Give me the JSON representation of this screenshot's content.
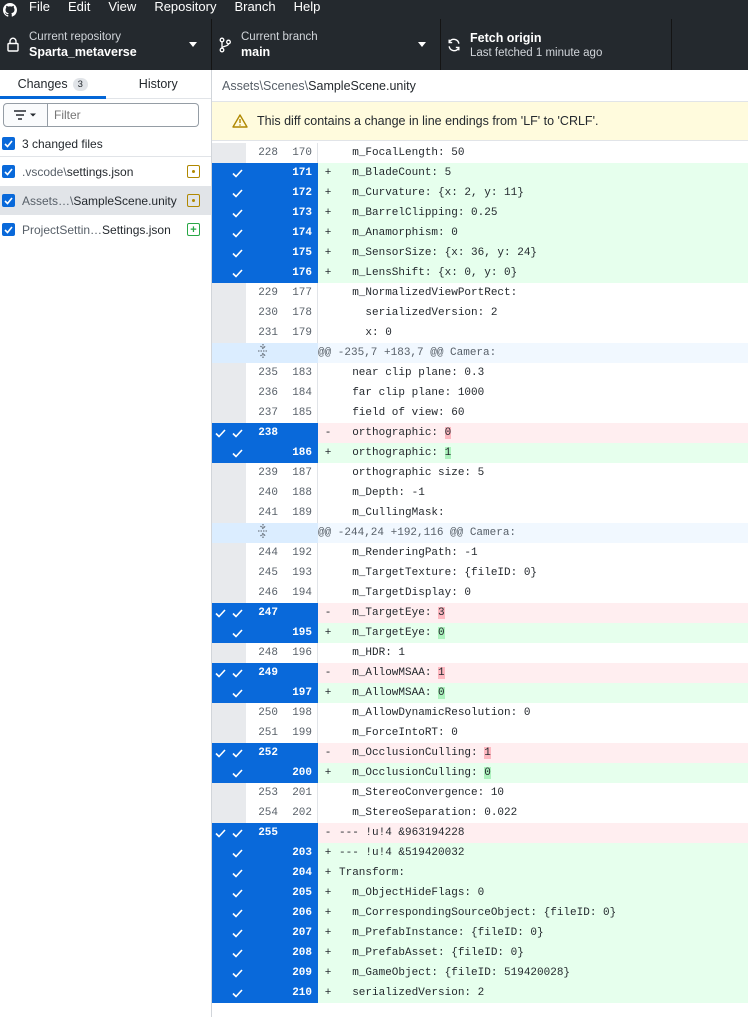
{
  "menu": [
    "File",
    "Edit",
    "View",
    "Repository",
    "Branch",
    "Help"
  ],
  "toolbar": {
    "repo_label": "Current repository",
    "repo_value": "Sparta_metaverse",
    "branch_label": "Current branch",
    "branch_value": "main",
    "fetch_label": "Fetch origin",
    "fetch_sub": "Last fetched 1 minute ago"
  },
  "sidebar": {
    "tab_changes": "Changes",
    "tab_changes_count": "3",
    "tab_history": "History",
    "filter_placeholder": "Filter",
    "changed_files": "3 changed files",
    "files": [
      {
        "prefix": ".vscode\\",
        "name": "settings.json",
        "status": "modified"
      },
      {
        "prefix": "Assets…\\",
        "name": "SampleScene.unity",
        "status": "modified"
      },
      {
        "prefix": "ProjectSettin…",
        "name": "Settings.json",
        "status": "added"
      }
    ]
  },
  "main": {
    "breadcrumb_path": "Assets\\Scenes\\",
    "breadcrumb_file": "SampleScene.unity",
    "warning": "This diff contains a change in line endings from 'LF' to 'CRLF'."
  },
  "diff": [
    {
      "t": "ctx",
      "o": "228",
      "n": "170",
      "c": "  m_FocalLength: 50"
    },
    {
      "t": "add",
      "o": "",
      "n": "171",
      "c": "  m_BladeCount: 5"
    },
    {
      "t": "add",
      "o": "",
      "n": "172",
      "c": "  m_Curvature: {x: 2, y: 11}"
    },
    {
      "t": "add",
      "o": "",
      "n": "173",
      "c": "  m_BarrelClipping: 0.25"
    },
    {
      "t": "add",
      "o": "",
      "n": "174",
      "c": "  m_Anamorphism: 0"
    },
    {
      "t": "add",
      "o": "",
      "n": "175",
      "c": "  m_SensorSize: {x: 36, y: 24}"
    },
    {
      "t": "add",
      "o": "",
      "n": "176",
      "c": "  m_LensShift: {x: 0, y: 0}"
    },
    {
      "t": "ctx",
      "o": "229",
      "n": "177",
      "c": "  m_NormalizedViewPortRect:"
    },
    {
      "t": "ctx",
      "o": "230",
      "n": "178",
      "c": "    serializedVersion: 2"
    },
    {
      "t": "ctx",
      "o": "231",
      "n": "179",
      "c": "    x: 0"
    },
    {
      "t": "hunk",
      "c": "@@ -235,7 +183,7 @@ Camera:"
    },
    {
      "t": "ctx",
      "o": "235",
      "n": "183",
      "c": "  near clip plane: 0.3"
    },
    {
      "t": "ctx",
      "o": "236",
      "n": "184",
      "c": "  far clip plane: 1000"
    },
    {
      "t": "ctx",
      "o": "237",
      "n": "185",
      "c": "  field of view: 60"
    },
    {
      "t": "del",
      "o": "238",
      "n": "",
      "c": "  orthographic: ",
      "h": "0"
    },
    {
      "t": "add",
      "o": "",
      "n": "186",
      "c": "  orthographic: ",
      "h": "1"
    },
    {
      "t": "ctx",
      "o": "239",
      "n": "187",
      "c": "  orthographic size: 5"
    },
    {
      "t": "ctx",
      "o": "240",
      "n": "188",
      "c": "  m_Depth: -1"
    },
    {
      "t": "ctx",
      "o": "241",
      "n": "189",
      "c": "  m_CullingMask:"
    },
    {
      "t": "hunk",
      "c": "@@ -244,24 +192,116 @@ Camera:"
    },
    {
      "t": "ctx",
      "o": "244",
      "n": "192",
      "c": "  m_RenderingPath: -1"
    },
    {
      "t": "ctx",
      "o": "245",
      "n": "193",
      "c": "  m_TargetTexture: {fileID: 0}"
    },
    {
      "t": "ctx",
      "o": "246",
      "n": "194",
      "c": "  m_TargetDisplay: 0"
    },
    {
      "t": "del",
      "o": "247",
      "n": "",
      "c": "  m_TargetEye: ",
      "h": "3"
    },
    {
      "t": "add",
      "o": "",
      "n": "195",
      "c": "  m_TargetEye: ",
      "h": "0"
    },
    {
      "t": "ctx",
      "o": "248",
      "n": "196",
      "c": "  m_HDR: 1"
    },
    {
      "t": "del",
      "o": "249",
      "n": "",
      "c": "  m_AllowMSAA: ",
      "h": "1"
    },
    {
      "t": "add",
      "o": "",
      "n": "197",
      "c": "  m_AllowMSAA: ",
      "h": "0"
    },
    {
      "t": "ctx",
      "o": "250",
      "n": "198",
      "c": "  m_AllowDynamicResolution: 0"
    },
    {
      "t": "ctx",
      "o": "251",
      "n": "199",
      "c": "  m_ForceIntoRT: 0"
    },
    {
      "t": "del",
      "o": "252",
      "n": "",
      "c": "  m_OcclusionCulling: ",
      "h": "1"
    },
    {
      "t": "add",
      "o": "",
      "n": "200",
      "c": "  m_OcclusionCulling: ",
      "h": "0"
    },
    {
      "t": "ctx",
      "o": "253",
      "n": "201",
      "c": "  m_StereoConvergence: 10"
    },
    {
      "t": "ctx",
      "o": "254",
      "n": "202",
      "c": "  m_StereoSeparation: 0.022"
    },
    {
      "t": "del",
      "o": "255",
      "n": "",
      "c": "--- !u!4 &963194228"
    },
    {
      "t": "add",
      "o": "",
      "n": "203",
      "c": "--- !u!4 &519420032"
    },
    {
      "t": "add",
      "o": "",
      "n": "204",
      "c": "Transform:"
    },
    {
      "t": "add",
      "o": "",
      "n": "205",
      "c": "  m_ObjectHideFlags: 0"
    },
    {
      "t": "add",
      "o": "",
      "n": "206",
      "c": "  m_CorrespondingSourceObject: {fileID: 0}"
    },
    {
      "t": "add",
      "o": "",
      "n": "207",
      "c": "  m_PrefabInstance: {fileID: 0}"
    },
    {
      "t": "add",
      "o": "",
      "n": "208",
      "c": "  m_PrefabAsset: {fileID: 0}"
    },
    {
      "t": "add",
      "o": "",
      "n": "209",
      "c": "  m_GameObject: {fileID: 519420028}"
    },
    {
      "t": "add",
      "o": "",
      "n": "210",
      "c": "  serializedVersion: 2"
    }
  ]
}
